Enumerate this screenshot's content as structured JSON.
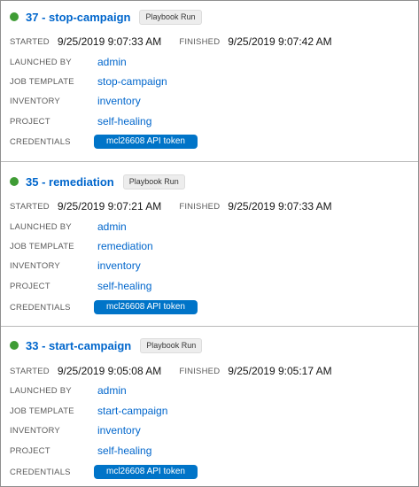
{
  "colors": {
    "success": "#3f9c35",
    "link": "#0066cc",
    "badge": "#0074c8"
  },
  "icons": {
    "status": "status-success-icon"
  },
  "labels": {
    "started": "STARTED",
    "finished": "FINISHED",
    "launched_by": "LAUNCHED BY",
    "job_template": "JOB TEMPLATE",
    "inventory": "INVENTORY",
    "project": "PROJECT",
    "credentials": "CREDENTIALS"
  },
  "jobs": [
    {
      "title": "37 - stop-campaign",
      "type": "Playbook Run",
      "started": "9/25/2019 9:07:33 AM",
      "finished": "9/25/2019 9:07:42 AM",
      "launched_by": "admin",
      "job_template": "stop-campaign",
      "inventory": "inventory",
      "project": "self-healing",
      "credential": "mcl26608 API token"
    },
    {
      "title": "35 - remediation",
      "type": "Playbook Run",
      "started": "9/25/2019 9:07:21 AM",
      "finished": "9/25/2019 9:07:33 AM",
      "launched_by": "admin",
      "job_template": "remediation",
      "inventory": "inventory",
      "project": "self-healing",
      "credential": "mcl26608 API token"
    },
    {
      "title": "33 - start-campaign",
      "type": "Playbook Run",
      "started": "9/25/2019 9:05:08 AM",
      "finished": "9/25/2019 9:05:17 AM",
      "launched_by": "admin",
      "job_template": "start-campaign",
      "inventory": "inventory",
      "project": "self-healing",
      "credential": "mcl26608 API token"
    }
  ]
}
